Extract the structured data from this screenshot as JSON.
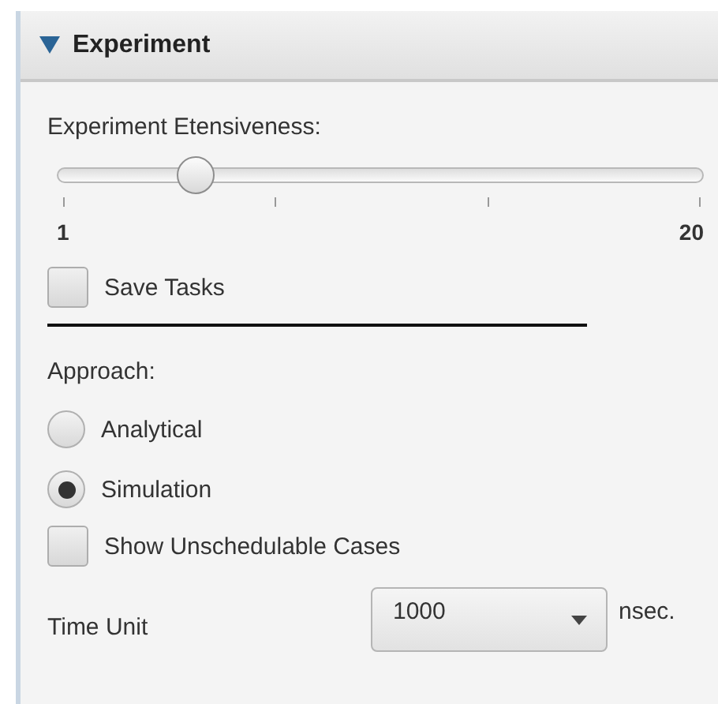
{
  "panel": {
    "title": "Experiment",
    "expanded": true
  },
  "extensiveness": {
    "label": "Experiment Etensiveness:",
    "level": 0.215,
    "min_label": "1",
    "max_label": "20"
  },
  "save_tasks": {
    "label": "Save Tasks",
    "checked": false
  },
  "approach": {
    "label": "Approach:",
    "options": [
      {
        "label": "Analytical",
        "selected": false
      },
      {
        "label": "Simulation",
        "selected": true
      }
    ]
  },
  "show_unschedulable": {
    "label": "Show Unschedulable Cases",
    "checked": false
  },
  "time_unit": {
    "label": "Time Unit",
    "value": "1000",
    "unit": "nsec."
  }
}
